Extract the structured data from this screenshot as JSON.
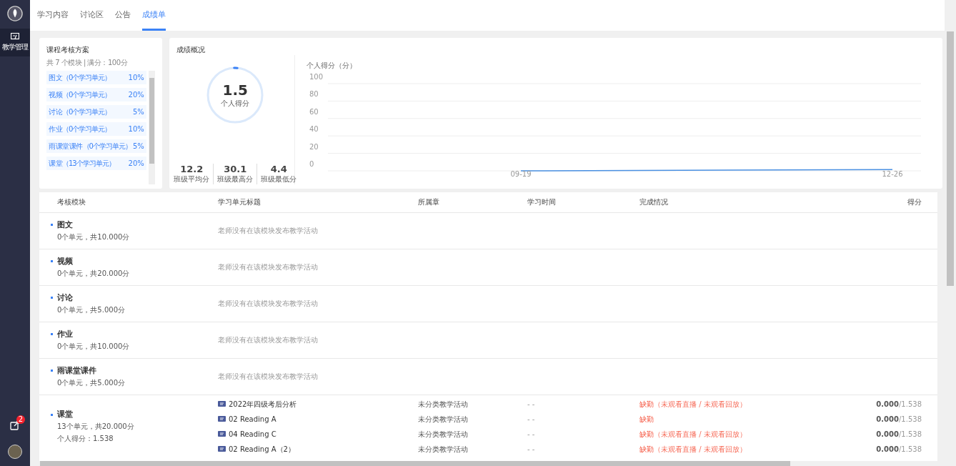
{
  "sidebar": {
    "items": [
      {
        "label": "教学管理",
        "selected": true
      }
    ],
    "notification_badge": "2"
  },
  "tabs": [
    {
      "label": "学习内容",
      "selected": false
    },
    {
      "label": "讨论区",
      "selected": false
    },
    {
      "label": "公告",
      "selected": false
    },
    {
      "label": "成绩单",
      "selected": true
    }
  ],
  "scheme": {
    "title": "课程考核方案",
    "summary": "共 7 个模块 | 满分：100分",
    "items": [
      {
        "name": "图文",
        "units": "（0个学习单元）",
        "percent": "10%"
      },
      {
        "name": "视频",
        "units": "（0个学习单元）",
        "percent": "20%"
      },
      {
        "name": "讨论",
        "units": "（0个学习单元）",
        "percent": "5%"
      },
      {
        "name": "作业",
        "units": "（0个学习单元）",
        "percent": "10%"
      },
      {
        "name": "雨课堂课件",
        "units": "（0个学习单元）",
        "percent": "5%"
      },
      {
        "name": "课堂",
        "units": "（13个学习单元）",
        "percent": "20%"
      }
    ]
  },
  "overview": {
    "title": "成绩概况",
    "score": "1.5",
    "score_label": "个人得分",
    "level": 0.015,
    "stats": [
      {
        "value": "12.2",
        "label": "班级平均分"
      },
      {
        "value": "30.1",
        "label": "班级最高分"
      },
      {
        "value": "4.4",
        "label": "班级最低分"
      }
    ],
    "chart_data": {
      "type": "line",
      "grid": true,
      "ylabel": "个人得分（分）",
      "categories": [
        "09-19",
        "12-26"
      ],
      "ylim": [
        0,
        100
      ],
      "yticks": [
        0,
        20,
        40,
        60,
        80,
        100
      ],
      "series": [
        {
          "color": "#4a90e2",
          "values": [
            0,
            1.5
          ]
        }
      ]
    }
  },
  "table": {
    "columns": [
      "考核模块",
      "学习单元标题",
      "所属章",
      "学习时间",
      "完成情况",
      "得分"
    ],
    "rows": [
      {
        "name": "图文",
        "summary": "0个单元，共10.000分",
        "message": "老师没有在该模块发布教学活动",
        "units": []
      },
      {
        "name": "视频",
        "summary": "0个单元，共20.000分",
        "message": "老师没有在该模块发布教学活动",
        "units": []
      },
      {
        "name": "讨论",
        "summary": "0个单元，共5.000分",
        "message": "老师没有在该模块发布教学活动",
        "units": []
      },
      {
        "name": "作业",
        "summary": "0个单元，共10.000分",
        "message": "老师没有在该模块发布教学活动",
        "units": []
      },
      {
        "name": "雨课堂课件",
        "summary": "0个单元，共5.000分",
        "message": "老师没有在该模块发布教学活动",
        "units": []
      },
      {
        "name": "课堂",
        "summary": "13个单元，共20.000分",
        "personal": "个人得分：1.538",
        "units": [
          {
            "title": "2022年四级考后分析",
            "chapter": "未分类教学活动",
            "time": "- -",
            "status": "缺勤",
            "detail": "（未观看直播 / 未观看回放）",
            "score": "0.000",
            "total": "/1.538"
          },
          {
            "title": "02 Reading A",
            "chapter": "未分类教学活动",
            "time": "- -",
            "status": "缺勤",
            "score": "0.000",
            "total": "/1.538"
          },
          {
            "title": "04 Reading C",
            "chapter": "未分类教学活动",
            "time": "- -",
            "status": "缺勤",
            "detail": "（未观看直播 / 未观看回放）",
            "score": "0.000",
            "total": "/1.538"
          },
          {
            "title": "02 Reading A（2）",
            "chapter": "未分类教学活动",
            "time": "- -",
            "status": "缺勤",
            "detail": "（未观看直播 / 未观看回放）",
            "score": "0.000",
            "total": "/1.538"
          }
        ]
      }
    ]
  }
}
